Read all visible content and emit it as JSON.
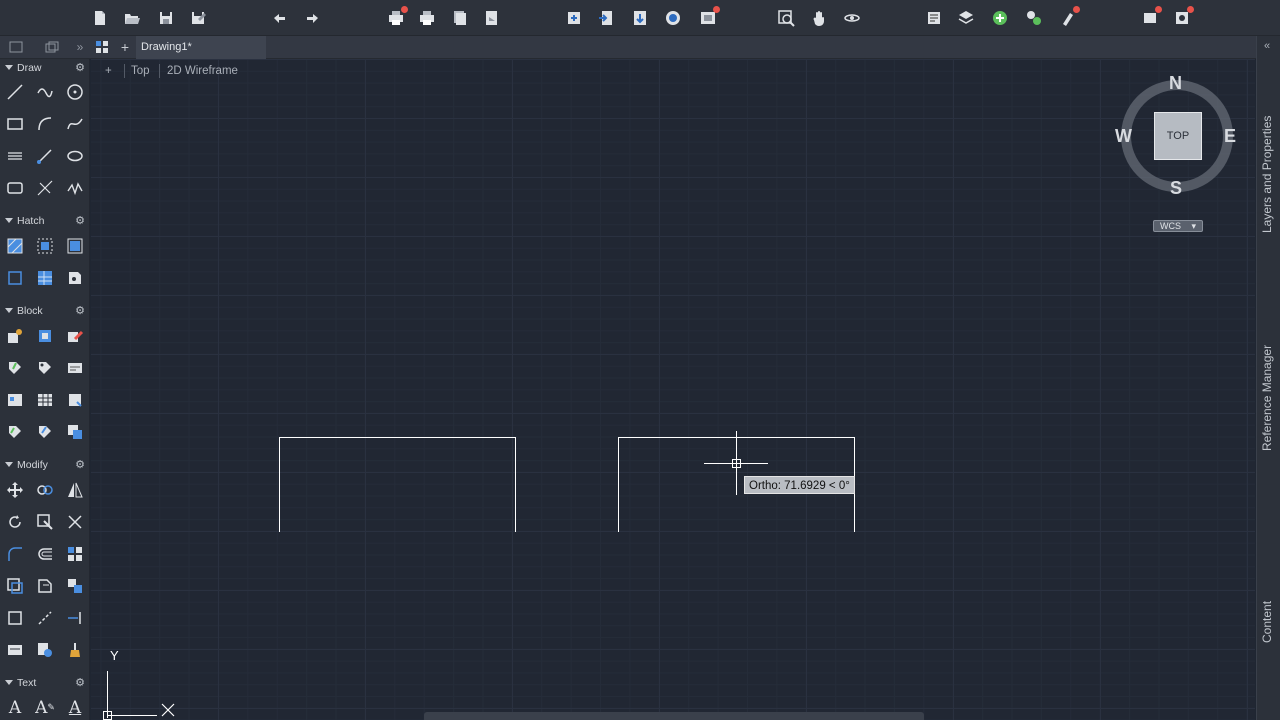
{
  "tab": {
    "title": "Drawing1*"
  },
  "viewport": {
    "plus": "+",
    "view": "Top",
    "visual_style": "2D Wireframe"
  },
  "palette": {
    "sections": [
      {
        "key": "draw",
        "label": "Draw"
      },
      {
        "key": "hatch",
        "label": "Hatch"
      },
      {
        "key": "block",
        "label": "Block"
      },
      {
        "key": "modify",
        "label": "Modify"
      },
      {
        "key": "text",
        "label": "Text"
      }
    ]
  },
  "viewcube": {
    "north": "N",
    "south": "S",
    "east": "E",
    "west": "W",
    "face": "TOP",
    "wcs": "WCS"
  },
  "ucs": {
    "y": "Y"
  },
  "tooltip": {
    "text": "Ortho: 71.6929 < 0°"
  },
  "right_panel": {
    "items": [
      "Layers and Properties",
      "Reference Manager",
      "Content"
    ]
  },
  "colors": {
    "canvas": "#212733",
    "toolbar": "#2d323b",
    "accent_red": "#e8524a",
    "line": "#ffffff"
  }
}
